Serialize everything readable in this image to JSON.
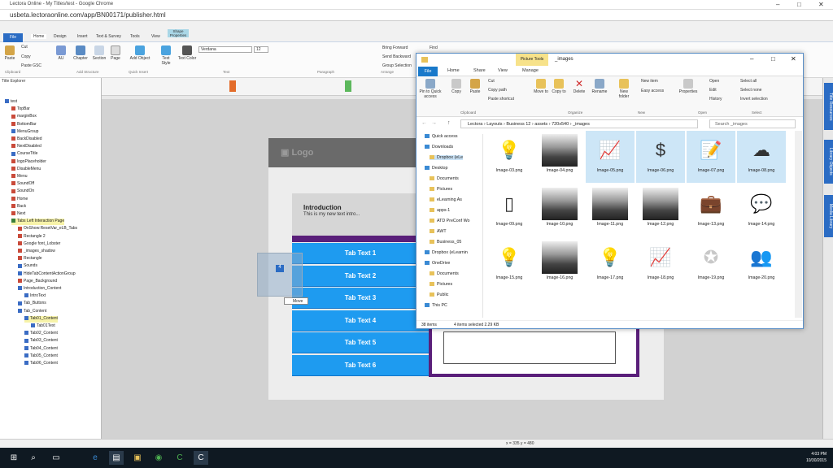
{
  "browser": {
    "title": "Lectora Online - My Titles/test - Google Chrome",
    "url": "usbeta.lectoraonline.com/app/BN00171/publisher.html"
  },
  "ribbon": {
    "file_tab": "File",
    "tabs": [
      "Home",
      "Design",
      "Insert",
      "Text & Survey",
      "Tools",
      "View",
      "Shape Properties"
    ],
    "clipboard": [
      "Paste",
      "Cut",
      "Copy",
      "Paste GSC"
    ],
    "insert_buttons": [
      "AU",
      "Chapter",
      "Section",
      "Page",
      "Add Object",
      "Text Style",
      "Text Color"
    ],
    "font_name": "Verdana",
    "font_size": "12",
    "arrange": [
      "Bring Forward",
      "Send Backward",
      "Group Selection"
    ],
    "find": "Find",
    "groups": [
      "Clipboard",
      "Add Structure",
      "Quick Insert",
      "Text",
      "Paragraph",
      "Arrange",
      "Editing"
    ]
  },
  "title_explorer": {
    "header": "Title Explorer",
    "items": [
      {
        "label": "test",
        "level": 0,
        "color": "bl"
      },
      {
        "label": "TopBar",
        "level": 1,
        "color": "r"
      },
      {
        "label": "marginBox",
        "level": 1,
        "color": "r"
      },
      {
        "label": "BottomBar",
        "level": 1,
        "color": "r"
      },
      {
        "label": "MenuGroup",
        "level": 1,
        "color": "bl"
      },
      {
        "label": "BackDisabled",
        "level": 1,
        "color": "r"
      },
      {
        "label": "NextDisabled",
        "level": 1,
        "color": "r"
      },
      {
        "label": "CourseTitle",
        "level": 1,
        "color": "bl"
      },
      {
        "label": "logoPlaceholder",
        "level": 1,
        "color": "r"
      },
      {
        "label": "DisableMenu",
        "level": 1,
        "color": "r"
      },
      {
        "label": "Menu",
        "level": 1,
        "color": "r"
      },
      {
        "label": "SoundOff",
        "level": 1,
        "color": "r"
      },
      {
        "label": "SoundOn",
        "level": 1,
        "color": "r"
      },
      {
        "label": "Home",
        "level": 1,
        "color": "r"
      },
      {
        "label": "Back",
        "level": 1,
        "color": "r"
      },
      {
        "label": "Next",
        "level": 1,
        "color": "r"
      },
      {
        "label": "Tabs Left Interaction Page",
        "level": 1,
        "color": "g",
        "selected": true
      },
      {
        "label": "OnShow:ResetVar_eLB_Tabs",
        "level": 2,
        "color": "r"
      },
      {
        "label": "Rectangle 2",
        "level": 2,
        "color": "r"
      },
      {
        "label": "Google font_Lobster",
        "level": 2,
        "color": "r"
      },
      {
        "label": "_images_shadow",
        "level": 2,
        "color": "r"
      },
      {
        "label": "Rectangle",
        "level": 2,
        "color": "r"
      },
      {
        "label": "Sounds",
        "level": 2,
        "color": "bl"
      },
      {
        "label": "HideTabContentActionGroup",
        "level": 2,
        "color": "bl"
      },
      {
        "label": "Page_Background",
        "level": 2,
        "color": "r"
      },
      {
        "label": "Introduction_Content",
        "level": 2,
        "color": "bl"
      },
      {
        "label": "IntroText",
        "level": 3,
        "color": "bl"
      },
      {
        "label": "Tab_Buttons",
        "level": 2,
        "color": "bl"
      },
      {
        "label": "Tab_Content",
        "level": 2,
        "color": "bl"
      },
      {
        "label": "Tab01_Content",
        "level": 3,
        "color": "bl",
        "selected": true
      },
      {
        "label": "Tab01Text",
        "level": 4,
        "color": "bl"
      },
      {
        "label": "Tab02_Content",
        "level": 3,
        "color": "bl"
      },
      {
        "label": "Tab03_Content",
        "level": 3,
        "color": "bl"
      },
      {
        "label": "Tab04_Content",
        "level": 3,
        "color": "bl"
      },
      {
        "label": "Tab05_Content",
        "level": 3,
        "color": "bl"
      },
      {
        "label": "Tab06_Content",
        "level": 3,
        "color": "bl"
      }
    ]
  },
  "page": {
    "logo": "Logo",
    "intro_title": "Introduction",
    "intro_text": "This is my new text intro...",
    "tabs": [
      "Tab Text 1",
      "Tab Text 2",
      "Tab Text 3",
      "Tab Text 4",
      "Tab Text 5",
      "Tab Text 6"
    ],
    "drag_badge": "4",
    "move_tooltip": "Move"
  },
  "right_tabs": [
    "Title Resources",
    "Library Objects",
    "Media Library"
  ],
  "explorer": {
    "picture_tools": "Picture Tools",
    "folder_title": "_images",
    "tabs": [
      "File",
      "Home",
      "Share",
      "View",
      "Manage"
    ],
    "ribbon_buttons": [
      "Pin to Quick access",
      "Copy",
      "Paste",
      "Cut",
      "Copy path",
      "Paste shortcut",
      "Move to",
      "Copy to",
      "Delete",
      "Rename",
      "New folder",
      "New item",
      "Easy access",
      "Properties",
      "Open",
      "Edit",
      "History",
      "Select all",
      "Select none",
      "Invert selection"
    ],
    "ribbon_groups": [
      "Clipboard",
      "Organize",
      "New",
      "Open",
      "Select"
    ],
    "path": [
      "Lectora",
      "Layouts",
      "Business 12",
      "assets",
      "720x540",
      "_images"
    ],
    "search_placeholder": "Search _images",
    "nav": [
      {
        "label": "Quick access",
        "type": "star"
      },
      {
        "label": "Downloads",
        "type": "b"
      },
      {
        "label": "Dropbox (eLe",
        "type": "y",
        "selected": true
      },
      {
        "label": "Desktop",
        "type": "b"
      },
      {
        "label": "Documents",
        "type": "y"
      },
      {
        "label": "Pictures",
        "type": "y"
      },
      {
        "label": "eLearning As",
        "type": "y"
      },
      {
        "label": "apps-1",
        "type": "y"
      },
      {
        "label": "ATD PreConf Wo",
        "type": "y"
      },
      {
        "label": "AWT",
        "type": "y"
      },
      {
        "label": "Business_05",
        "type": "y"
      },
      {
        "label": "Dropbox (eLearnin",
        "type": "b"
      },
      {
        "label": "OneDrive",
        "type": "b"
      },
      {
        "label": "Documents",
        "type": "y"
      },
      {
        "label": "Pictures",
        "type": "y"
      },
      {
        "label": "Public",
        "type": "y"
      },
      {
        "label": "This PC",
        "type": "b"
      }
    ],
    "files": [
      {
        "name": "Image-03.png",
        "kind": "bulb",
        "sel": false
      },
      {
        "name": "Image-04.png",
        "kind": "photo",
        "sel": false
      },
      {
        "name": "Image-05.png",
        "kind": "chart",
        "sel": true
      },
      {
        "name": "Image-06.png",
        "kind": "dollar",
        "sel": true
      },
      {
        "name": "Image-07.png",
        "kind": "doc",
        "sel": true
      },
      {
        "name": "Image-08.png",
        "kind": "cloud",
        "sel": true
      },
      {
        "name": "Image-09.png",
        "kind": "phone",
        "sel": false
      },
      {
        "name": "Image-10.png",
        "kind": "photo",
        "sel": false
      },
      {
        "name": "Image-11.png",
        "kind": "photo",
        "sel": false
      },
      {
        "name": "Image-12.png",
        "kind": "photo",
        "sel": false
      },
      {
        "name": "Image-13.png",
        "kind": "briefcase",
        "sel": false
      },
      {
        "name": "Image-14.png",
        "kind": "chat",
        "sel": false
      },
      {
        "name": "Image-15.png",
        "kind": "bulb",
        "sel": false
      },
      {
        "name": "Image-16.png",
        "kind": "photo",
        "sel": false
      },
      {
        "name": "Image-17.png",
        "kind": "bulblight",
        "sel": false
      },
      {
        "name": "Image-18.png",
        "kind": "chartlight",
        "sel": false
      },
      {
        "name": "Image-19.png",
        "kind": "award",
        "sel": false
      },
      {
        "name": "Image-20.png",
        "kind": "people",
        "sel": false
      }
    ],
    "status_items": "38 items",
    "status_selected": "4 items selected  2.29 KB"
  },
  "status": {
    "position": "x = 335   y = 480"
  },
  "taskbar": {
    "time": "4:03 PM",
    "date": "10/30/2015"
  }
}
